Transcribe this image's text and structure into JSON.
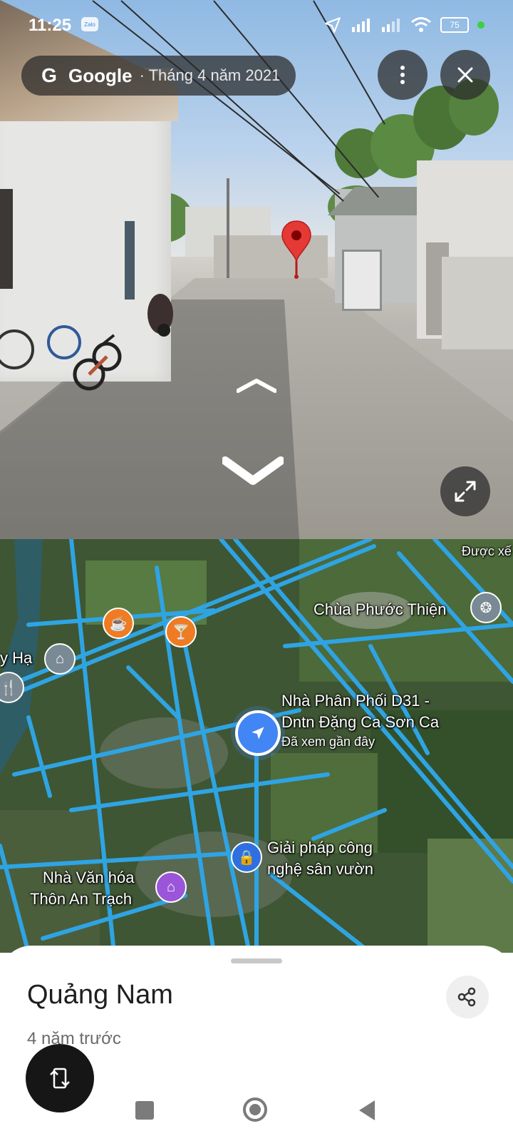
{
  "status_bar": {
    "time": "11:25",
    "zalo_label": "Zalo",
    "battery": "75",
    "icons": [
      "location-arrow-icon",
      "signal-icon",
      "signal-icon",
      "wifi-icon",
      "battery-icon",
      "dot-icon"
    ]
  },
  "streetview": {
    "brand": "Google",
    "date": "· Tháng 4 năm 2021",
    "menu_icon": "more-vertical-icon",
    "close_icon": "close-icon",
    "expand_icon": "expand-icon",
    "pin_color": "#e53935"
  },
  "map": {
    "labels": {
      "chua": "Chùa Phước Thiện",
      "duoc_xem": "Được xế",
      "y_ha": "y Hạ",
      "nha_phan_phoi_1": "Nhà Phân Phối D31 -",
      "nha_phan_phoi_2": "Dntn Đặng Ca Sơn Ca",
      "da_xem": "Đã xem gần đây",
      "giai_phap_1": "Giải pháp công",
      "giai_phap_2": "nghệ sân vườn",
      "nha_van_hoa_1": "Nhà Văn hóa",
      "nha_van_hoa_2": "Thôn An Trạch"
    },
    "road_color": "#2fa4e3",
    "poi_colors": {
      "cafe": "#ef7b23",
      "bar": "#ef7b23",
      "temple": "#7a8a94",
      "bridge": "#7a8a94",
      "shopping": "#2f6fe0",
      "community": "#9a55d9",
      "location": "#4285f4"
    }
  },
  "sheet": {
    "title": "Quảng Nam",
    "subtitle": "4 năm trước",
    "share_icon": "share-icon",
    "swap_icon": "rotate-swap-icon"
  },
  "nav_bar": {
    "icons": [
      "recents-icon",
      "home-icon",
      "back-icon"
    ]
  }
}
